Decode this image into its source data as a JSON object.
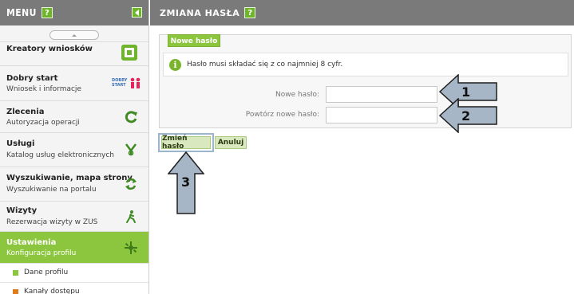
{
  "sidebar": {
    "title": "MENU",
    "help": "?",
    "items": [
      {
        "title": "Kreatory wniosków",
        "subtitle": ""
      },
      {
        "title": "Dobry start",
        "subtitle": "Wniosek i informacje"
      },
      {
        "title": "Zlecenia",
        "subtitle": "Autoryzacja operacji"
      },
      {
        "title": "Usługi",
        "subtitle": "Katalog usług elektronicznych"
      },
      {
        "title": "Wyszukiwanie, mapa strony",
        "subtitle": "Wyszukiwanie na portalu"
      },
      {
        "title": "Wizyty",
        "subtitle": "Rezerwacja wizyty w ZUS"
      },
      {
        "title": "Ustawienia",
        "subtitle": "Konfiguracja profilu"
      }
    ],
    "subitems": [
      {
        "label": "Dane profilu",
        "color": "#8cc63e"
      },
      {
        "label": "Kanały dostępu",
        "color": "#e07b1c"
      }
    ],
    "badges": {
      "dobry_start_logo": "DOBRY START"
    }
  },
  "main": {
    "title": "ZMIANA HASŁA",
    "help": "?",
    "tab_label": "Nowe hasło",
    "info_text": "Hasło musi składać się z co najmniej 8 cyfr.",
    "fields": [
      {
        "label": "Nowe hasło:",
        "value": ""
      },
      {
        "label": "Powtórz nowe hasło:",
        "value": ""
      }
    ],
    "buttons": {
      "change": "Zmień hasło",
      "cancel": "Anuluj"
    }
  },
  "annotations": [
    "1",
    "2",
    "3"
  ],
  "colors": {
    "accent": "#8cc63e",
    "header": "#7a7a7a",
    "arrow": "#a7b6c6"
  }
}
